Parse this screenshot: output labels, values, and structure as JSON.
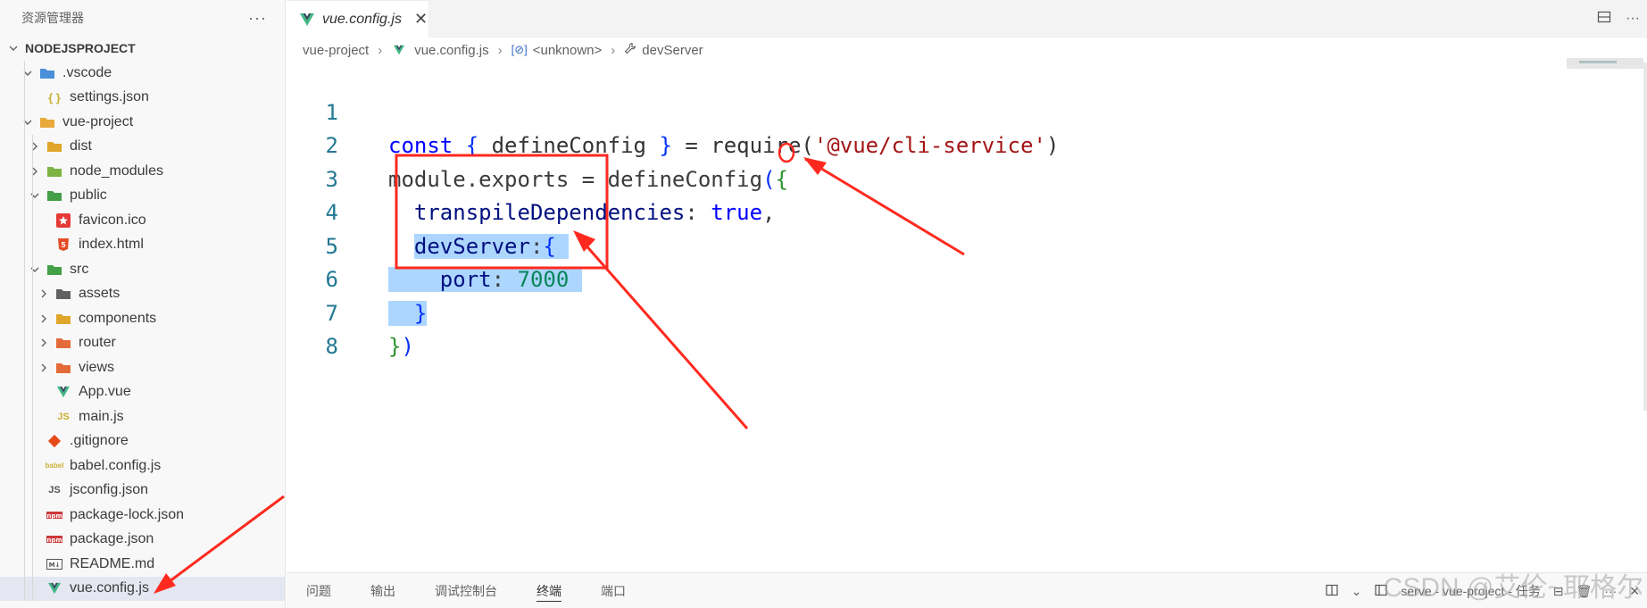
{
  "explorer": {
    "header": "资源管理器",
    "more": "···",
    "project": "NODEJSPROJECT",
    "tree": [
      {
        "label": ".vscode",
        "level": 1,
        "chevron": "down",
        "icon": "vscode-folder-icon",
        "color": "#4a8fd9"
      },
      {
        "label": "settings.json",
        "level": 2,
        "chevron": "",
        "icon": "json-braces-icon",
        "color": "#cbb036"
      },
      {
        "label": "vue-project",
        "level": 1,
        "chevron": "down",
        "icon": "folder-open-icon",
        "color": "#e8a93a"
      },
      {
        "label": "dist",
        "level": 2,
        "chevron": "right",
        "icon": "dist-folder-icon",
        "color": "#e0a52a"
      },
      {
        "label": "node_modules",
        "level": 2,
        "chevron": "right",
        "icon": "node-folder-icon",
        "color": "#7cb342"
      },
      {
        "label": "public",
        "level": 2,
        "chevron": "down",
        "icon": "public-folder-icon",
        "color": "#43a047"
      },
      {
        "label": "favicon.ico",
        "level": 3,
        "chevron": "",
        "icon": "star-icon",
        "color": "#e53935"
      },
      {
        "label": "index.html",
        "level": 3,
        "chevron": "",
        "icon": "html5-icon",
        "color": "#e44d26"
      },
      {
        "label": "src",
        "level": 2,
        "chevron": "down",
        "icon": "src-folder-icon",
        "color": "#43a047"
      },
      {
        "label": "assets",
        "level": 3,
        "chevron": "right",
        "icon": "assets-folder-icon",
        "color": "#616161"
      },
      {
        "label": "components",
        "level": 3,
        "chevron": "right",
        "icon": "components-folder-icon",
        "color": "#e0a52a"
      },
      {
        "label": "router",
        "level": 3,
        "chevron": "right",
        "icon": "router-folder-icon",
        "color": "#e36b3a"
      },
      {
        "label": "views",
        "level": 3,
        "chevron": "right",
        "icon": "views-folder-icon",
        "color": "#e36b3a"
      },
      {
        "label": "App.vue",
        "level": 3,
        "chevron": "",
        "icon": "vue-icon",
        "color": "#41b883"
      },
      {
        "label": "main.js",
        "level": 3,
        "chevron": "",
        "icon": "js-icon",
        "color": "#cbb036"
      },
      {
        "label": ".gitignore",
        "level": 2,
        "chevron": "",
        "icon": "git-icon",
        "color": "#e64a19"
      },
      {
        "label": "babel.config.js",
        "level": 2,
        "chevron": "",
        "icon": "babel-icon",
        "color": "#cbb036"
      },
      {
        "label": "jsconfig.json",
        "level": 2,
        "chevron": "",
        "icon": "jsconfig-icon",
        "color": "#cbb036"
      },
      {
        "label": "package-lock.json",
        "level": 2,
        "chevron": "",
        "icon": "npm-icon",
        "color": "#cb3837"
      },
      {
        "label": "package.json",
        "level": 2,
        "chevron": "",
        "icon": "npm-icon",
        "color": "#cb3837"
      },
      {
        "label": "README.md",
        "level": 2,
        "chevron": "",
        "icon": "markdown-icon",
        "color": "#555555"
      },
      {
        "label": "vue.config.js",
        "level": 2,
        "chevron": "",
        "icon": "vue-config-icon",
        "color": "#41b883",
        "selected": true
      }
    ]
  },
  "editor": {
    "tab": {
      "label": "vue.config.js",
      "close": "✕"
    },
    "breadcrumb": {
      "folder": "vue-project",
      "file": "vue.config.js",
      "unknown": "<unknown>",
      "symbol": "devServer"
    },
    "line_numbers": [
      "1",
      "2",
      "3",
      "4",
      "5",
      "6",
      "7",
      "8"
    ],
    "code": {
      "l1": {
        "kw": "const",
        "open": "{",
        "name": " defineConfig ",
        "close": "}",
        "eq": " = ",
        "req": "require",
        "p1": "(",
        "str": "'@vue/cli-service'",
        "p2": ")"
      },
      "l2": {
        "mod": "module",
        "dot": ".",
        "exp": "exports",
        "eq": " = ",
        "fn": "defineConfig",
        "p": "(",
        "b": "{"
      },
      "l3": {
        "prop": "transpileDependencies",
        "colon": ": ",
        "val": "true",
        "comma": ","
      },
      "l4": {
        "prop": "devServer",
        "colon": ":",
        "b": "{"
      },
      "l5": {
        "prop": "port",
        "colon": ": ",
        "val": "7000"
      },
      "l6": {
        "b": "}"
      },
      "l7": {
        "b": "}",
        "p": ")"
      }
    }
  },
  "panel": {
    "tabs": [
      "问题",
      "输出",
      "调试控制台",
      "终端",
      "端口"
    ],
    "active_tab": "终端",
    "task": "serve - vue-project - 任务"
  },
  "watermark": "CSDN @艾伦~耶格尔",
  "colors": {
    "accent": "#0066b8",
    "selection": "#add6ff",
    "annotation": "#ff2a1f"
  }
}
